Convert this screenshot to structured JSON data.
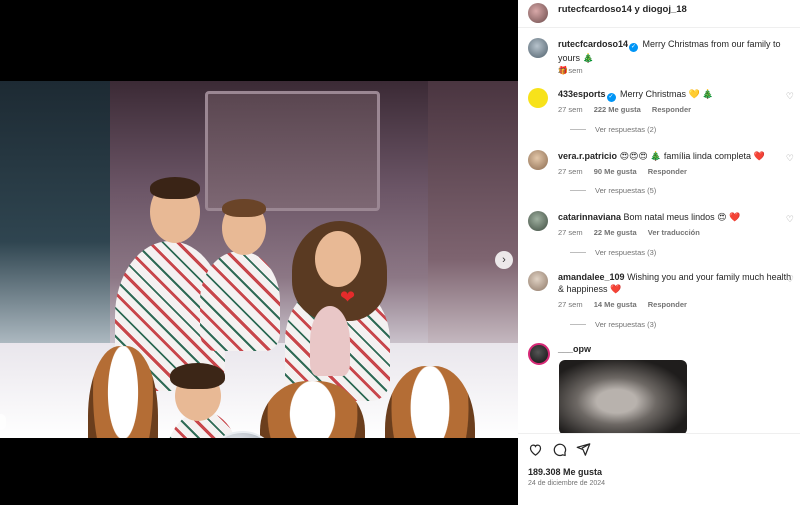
{
  "header": {
    "title": "rutecfcardoso14 y diogoj_18"
  },
  "caption": {
    "user": "rutecfcardoso14",
    "text": "Merry Christmas from our family to yours 🎄",
    "second_line": "🎁",
    "time": "27 sem"
  },
  "comments": [
    {
      "user": "433esports",
      "verified": true,
      "text": "Merry Christmas 💛 🎄",
      "time": "27 sem",
      "likes": "222 Me gusta",
      "reply": "Responder",
      "view_replies": "Ver respuestas (2)"
    },
    {
      "user": "vera.r.patricio",
      "verified": false,
      "text": "😍😍😍 🎄 família linda completa ❤️",
      "time": "27 sem",
      "likes": "90 Me gusta",
      "reply": "Responder",
      "view_replies": "Ver respuestas (5)"
    },
    {
      "user": "catarinnaviana",
      "verified": false,
      "text": "Bom natal meus lindos 😍 ❤️",
      "time": "27 sem",
      "likes": "22 Me gusta",
      "reply": "Ver traducción",
      "view_replies": "Ver respuestas (3)"
    },
    {
      "user": "amandalee_109",
      "verified": false,
      "text": "Wishing you and your family much health & happiness ❤️",
      "time": "27 sem",
      "likes": "14 Me gusta",
      "reply": "Responder",
      "view_replies": "Ver respuestas (3)"
    },
    {
      "user": "___opw",
      "verified": false,
      "text": ""
    }
  ],
  "footer": {
    "likes": "189.308 Me gusta",
    "date": "24 de diciembre de 2024"
  },
  "icons": {
    "like": "heart-icon",
    "comment": "comment-icon",
    "share": "send-icon",
    "next": "chevron-right-icon"
  },
  "colors": {
    "verified": "#0095f6",
    "meta_text": "#737373"
  }
}
